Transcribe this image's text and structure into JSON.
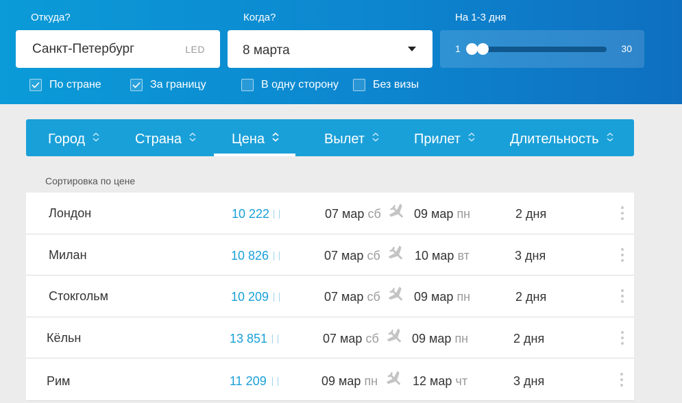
{
  "search": {
    "from_label": "Откуда?",
    "from_value": "Санкт-Петербург",
    "from_code": "LED",
    "when_label": "Когда?",
    "when_value": "8 марта",
    "duration_label": "На 1-3 дня",
    "range_min": "1",
    "range_max": "30",
    "range_selected": [
      1,
      3
    ]
  },
  "filters": [
    {
      "label": "По стране",
      "checked": true
    },
    {
      "label": "За границу",
      "checked": true
    },
    {
      "label": "В одну сторону",
      "checked": false
    },
    {
      "label": "Без визы",
      "checked": false
    }
  ],
  "columns": [
    {
      "label": "Город"
    },
    {
      "label": "Страна"
    },
    {
      "label": "Цена",
      "active": true
    },
    {
      "label": "Вылет"
    },
    {
      "label": "Прилет"
    },
    {
      "label": "Длительность"
    }
  ],
  "sort_caption": "Сортировка по цене",
  "results": [
    {
      "city": "Лондон",
      "price": "10 222",
      "dep_date": "07 мар",
      "dep_day": "сб",
      "arr_date": "09 мар",
      "arr_day": "пн",
      "duration": "2 дня"
    },
    {
      "city": "Милан",
      "price": "10 826",
      "dep_date": "07 мар",
      "dep_day": "сб",
      "arr_date": "10 мар",
      "arr_day": "вт",
      "duration": "3 дня"
    },
    {
      "city": "Стокгольм",
      "price": "10 209",
      "dep_date": "07 мар",
      "dep_day": "сб",
      "arr_date": "09 мар",
      "arr_day": "пн",
      "duration": "2 дня"
    },
    {
      "city": "Кёльн",
      "price": "13 851",
      "dep_date": "07 мар",
      "dep_day": "сб",
      "arr_date": "09 мар",
      "arr_day": "пн",
      "duration": "2 дня"
    },
    {
      "city": "Рим",
      "price": "11 209",
      "dep_date": "09 мар",
      "dep_day": "пн",
      "arr_date": "12 мар",
      "arr_day": "чт",
      "duration": "3 дня"
    }
  ],
  "icons": {
    "checkbox": "check-icon",
    "sort": "sort-arrows-icon",
    "flight": "plane-icon",
    "row_menu": "more-vertical-icon",
    "dropdown": "chevron-down-icon"
  },
  "colors": {
    "accent": "#1aa0d9",
    "hero_start": "#0b9bd8",
    "hero_end": "#0e6fc0",
    "weekday": "#9b9b9b"
  }
}
